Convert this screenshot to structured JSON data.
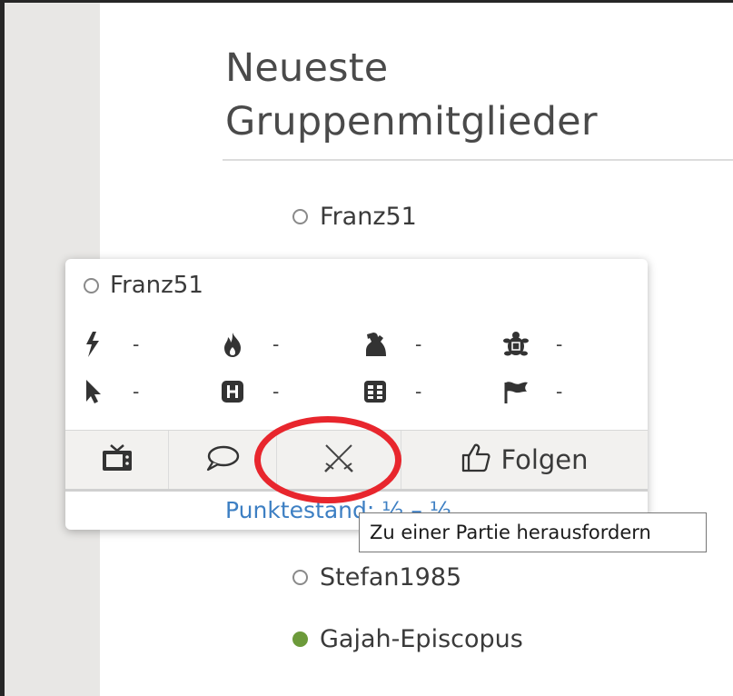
{
  "section": {
    "title_line1": "Neueste",
    "title_line2": "Gruppenmitglieder"
  },
  "members": [
    {
      "name": "Franz51",
      "status": "offline"
    },
    {
      "name": "Stefan1985",
      "status": "offline"
    },
    {
      "name": "Gajah-Episcopus",
      "status": "online"
    }
  ],
  "popup": {
    "username": "Franz51",
    "ratings": [
      {
        "icon": "bullet-icon",
        "value": "-"
      },
      {
        "icon": "blitz-icon",
        "value": "-"
      },
      {
        "icon": "rapid-icon",
        "value": "-"
      },
      {
        "icon": "classical-icon",
        "value": "-"
      },
      {
        "icon": "ultrabullet-icon",
        "value": "-"
      },
      {
        "icon": "horde-icon",
        "value": "-"
      },
      {
        "icon": "correspondence-icon",
        "value": "-"
      },
      {
        "icon": "racing-flag-icon",
        "value": "-"
      }
    ],
    "actions": {
      "follow_label": "Folgen"
    },
    "score_text": "Punktestand: ½ – ½"
  },
  "tooltip": {
    "text": "Zu einer Partie herausfordern"
  },
  "colors": {
    "online": "#6c9a3a",
    "link": "#3d7fc3",
    "highlight_ring": "#e8262d"
  }
}
